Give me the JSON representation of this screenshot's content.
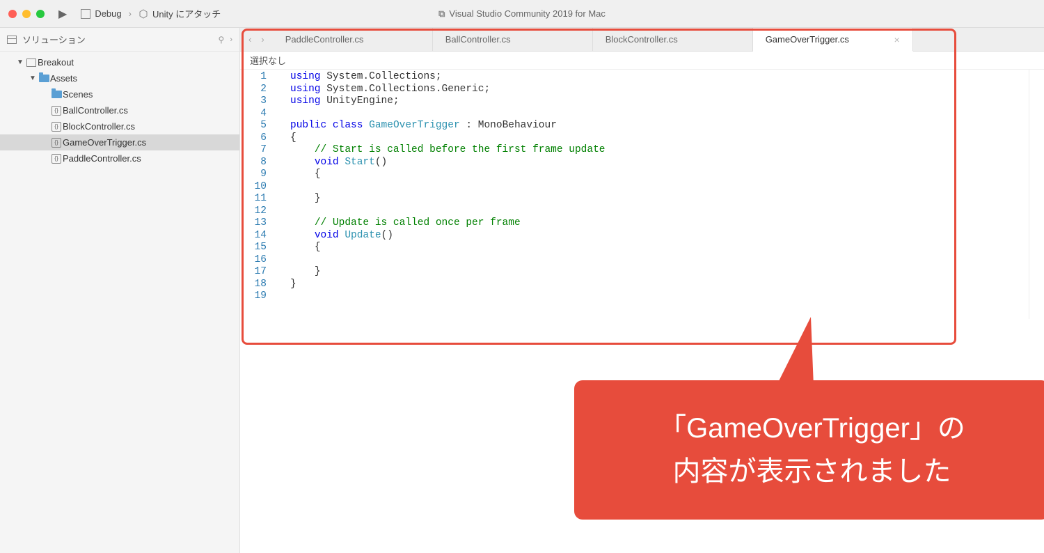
{
  "titlebar": {
    "debug": "Debug",
    "unity_attach": "Unity にアタッチ",
    "window_title": "Visual Studio Community 2019 for Mac"
  },
  "sidebar": {
    "header": "ソリューション",
    "project": "Breakout",
    "assets": "Assets",
    "scenes": "Scenes",
    "files": {
      "ball": "BallController.cs",
      "block": "BlockController.cs",
      "gameover": "GameOverTrigger.cs",
      "paddle": "PaddleController.cs"
    }
  },
  "tabs": {
    "paddle": "PaddleController.cs",
    "ball": "BallController.cs",
    "block": "BlockController.cs",
    "gameover": "GameOverTrigger.cs"
  },
  "breadcrumb": "選択なし",
  "code": {
    "lines": [
      "1",
      "2",
      "3",
      "4",
      "5",
      "6",
      "7",
      "8",
      "9",
      "10",
      "11",
      "12",
      "13",
      "14",
      "15",
      "16",
      "17",
      "18",
      "19"
    ],
    "l1_using": "using",
    "l1_rest": " System.Collections;",
    "l2_using": "using",
    "l2_rest": " System.Collections.Generic;",
    "l3_using": "using",
    "l3_rest": " UnityEngine;",
    "l5_public": "public",
    "l5_class": "class",
    "l5_name": "GameOverTrigger",
    "l5_rest": " : MonoBehaviour",
    "l7_comment": "// Start is called before the first frame update",
    "l8_void": "void",
    "l8_name": "Start",
    "l8_paren": "()",
    "l13_comment": "// Update is called once per frame",
    "l14_void": "void",
    "l14_name": "Update",
    "l14_paren": "()",
    "brace_open": "{",
    "brace_close": "}"
  },
  "callout": "「GameOverTrigger」の\n内容が表示されました"
}
